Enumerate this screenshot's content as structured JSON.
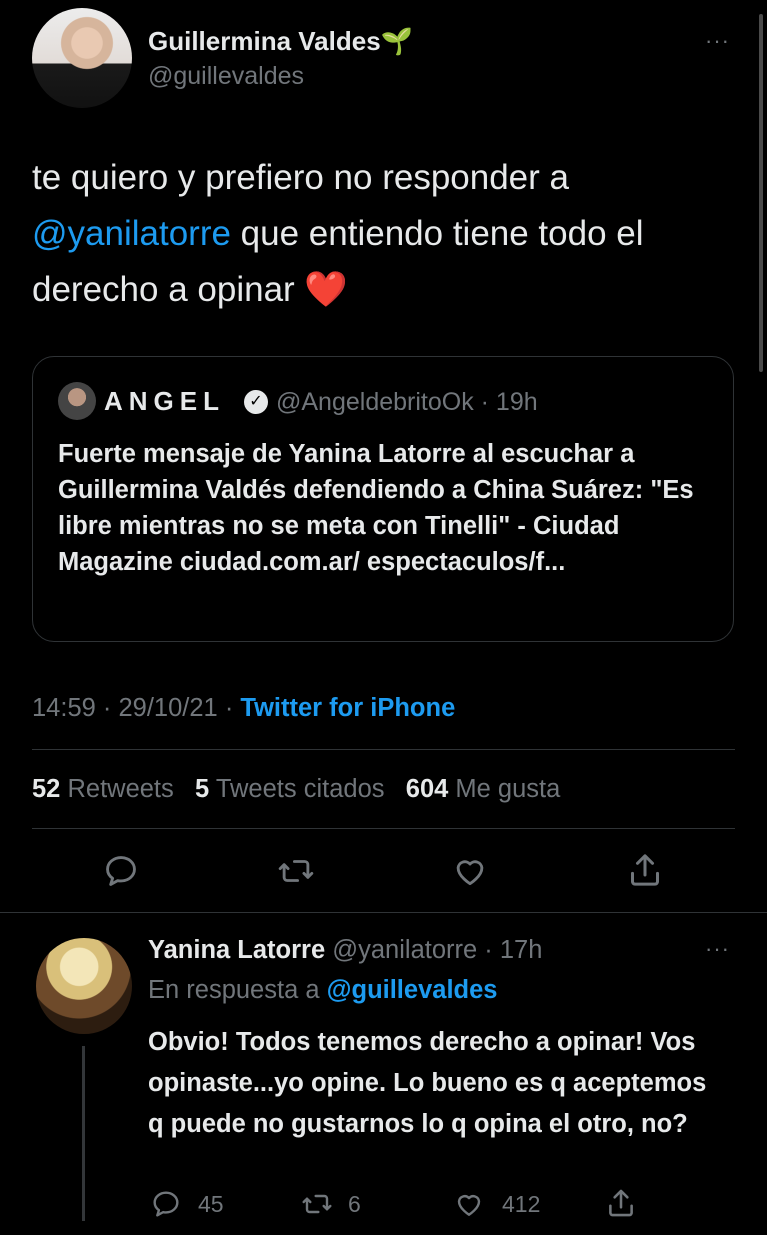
{
  "tweet": {
    "author_name": "Guillermina Valdes",
    "name_emoji": "🌱",
    "author_handle": "@guillevaldes",
    "text_part1": "te quiero y prefiero no responder a",
    "mention": "@yanilatorre",
    "text_part2": " que entiendo tiene todo el derecho a opinar ",
    "text_emoji": "❤️",
    "more": "···"
  },
  "quoted": {
    "name": "ANGEL",
    "handle_time": "@AngeldebritoOk · 19h",
    "text": "Fuerte mensaje de Yanina Latorre al escuchar a Guillermina Valdés defendiendo a China Suárez: \"Es libre mientras no se meta con Tinelli\" - Ciudad Magazine ciudad.com.ar/ espectaculos/f..."
  },
  "meta": {
    "time_date": "14:59 · 29/10/21 · ",
    "source": "Twitter for iPhone"
  },
  "stats": {
    "retweets_count": "52",
    "retweets_label": "Retweets",
    "quotes_count": "5",
    "quotes_label": "Tweets citados",
    "likes_count": "604",
    "likes_label": "Me gusta"
  },
  "reply": {
    "author_name": "Yanina Latorre",
    "handle_time": " @yanilatorre · 17h",
    "in_reply_prefix": "En respuesta a ",
    "in_reply_handle": "@guillevaldes",
    "text": "Obvio! Todos tenemos derecho a opinar! Vos opinaste...yo opine. Lo bueno es q aceptemos q puede no gustarnos lo q opina el otro, no?",
    "reply_count": "45",
    "retweet_count": "6",
    "like_count": "412",
    "more": "···"
  }
}
